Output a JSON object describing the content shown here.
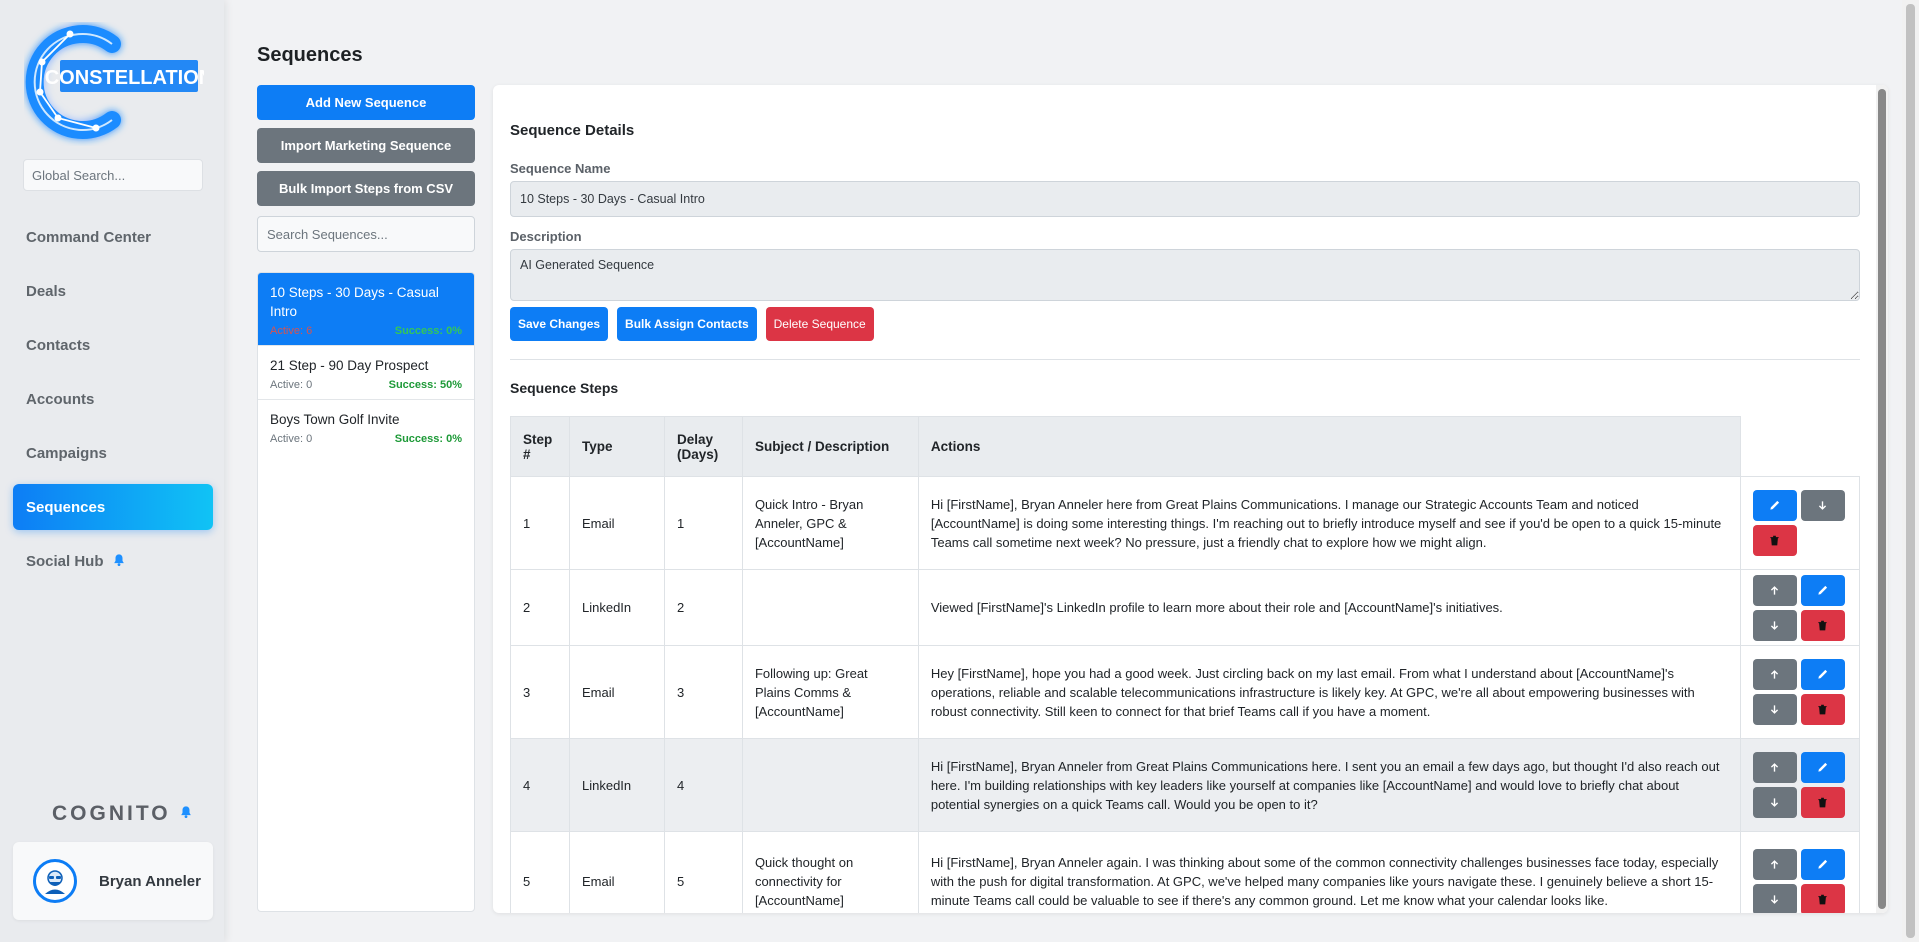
{
  "brand": {
    "logo_text": "CONSTELLATION",
    "accent": "#0d7df5"
  },
  "sidebar": {
    "search_placeholder": "Global Search...",
    "items": [
      {
        "label": "Command Center"
      },
      {
        "label": "Deals"
      },
      {
        "label": "Contacts"
      },
      {
        "label": "Accounts"
      },
      {
        "label": "Campaigns"
      },
      {
        "label": "Sequences",
        "active": true
      },
      {
        "label": "Social Hub",
        "icon": "bell-icon"
      }
    ],
    "cognito_label": "COGNITO",
    "user": {
      "name": "Bryan Anneler"
    }
  },
  "page": {
    "title": "Sequences"
  },
  "left_panel": {
    "add_button": "Add New Sequence",
    "import_button": "Import Marketing Sequence",
    "bulk_import_button": "Bulk Import Steps from CSV",
    "search_placeholder": "Search Sequences...",
    "sequences": [
      {
        "name": "10 Steps - 30 Days - Casual Intro",
        "active": "Active: 6",
        "success": "Success: 0%",
        "selected": true
      },
      {
        "name": "21 Step - 90 Day Prospect",
        "active": "Active: 0",
        "success": "Success: 50%"
      },
      {
        "name": "Boys Town Golf Invite",
        "active": "Active: 0",
        "success": "Success: 0%"
      }
    ]
  },
  "details": {
    "section_title": "Sequence Details",
    "name_label": "Sequence Name",
    "name_value": "10 Steps - 30 Days - Casual Intro",
    "description_label": "Description",
    "description_value": "AI Generated Sequence",
    "save_button": "Save Changes",
    "assign_button": "Bulk Assign Contacts",
    "delete_button": "Delete Sequence"
  },
  "steps": {
    "section_title": "Sequence Steps",
    "headers": {
      "step": "Step #",
      "type": "Type",
      "delay": "Delay (Days)",
      "subject": "Subject / Description",
      "actions": "Actions"
    },
    "rows": [
      {
        "step": "1",
        "type": "Email",
        "delay": "1",
        "subject": "Quick Intro - Bryan Anneler, GPC & [AccountName]",
        "body": "Hi [FirstName], Bryan Anneler here from Great Plains Communications. I manage our Strategic Accounts Team and noticed [AccountName] is doing some interesting things. I'm reaching out to briefly introduce myself and see if you'd be open to a quick 15-minute Teams call sometime next week? No pressure, just a friendly chat to explore how we might align."
      },
      {
        "step": "2",
        "type": "LinkedIn",
        "delay": "2",
        "subject": "",
        "body": "Viewed [FirstName]'s LinkedIn profile to learn more about their role and [AccountName]'s initiatives."
      },
      {
        "step": "3",
        "type": "Email",
        "delay": "3",
        "subject": "Following up: Great Plains Comms & [AccountName]",
        "body": "Hey [FirstName], hope you had a good week. Just circling back on my last email. From what I understand about [AccountName]'s operations, reliable and scalable telecommunications infrastructure is likely key. At GPC, we're all about empowering businesses with robust connectivity. Still keen to connect for that brief Teams call if you have a moment."
      },
      {
        "step": "4",
        "type": "LinkedIn",
        "delay": "4",
        "subject": "",
        "body": "Hi [FirstName], Bryan Anneler from Great Plains Communications here. I sent you an email a few days ago, but thought I'd also reach out here. I'm building relationships with key leaders like yourself at companies like [AccountName] and would love to briefly chat about potential synergies on a quick Teams call. Would you be open to it?"
      },
      {
        "step": "5",
        "type": "Email",
        "delay": "5",
        "subject": "Quick thought on connectivity for [AccountName]",
        "body": "Hi [FirstName], Bryan Anneler again. I was thinking about some of the common connectivity challenges businesses face today, especially with the push for digital transformation. At GPC, we've helped many companies like yours navigate these. I genuinely believe a short 15-minute Teams call could be valuable to see if there's any common ground. Let me know what your calendar looks like."
      }
    ]
  }
}
